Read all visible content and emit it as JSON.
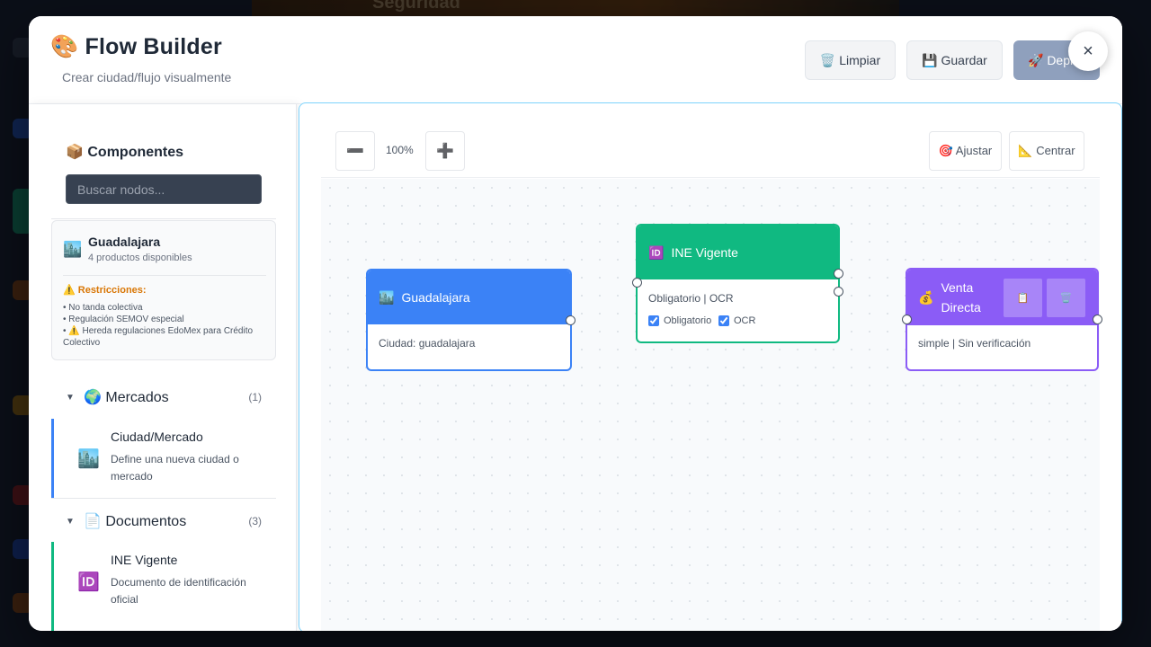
{
  "background": {
    "window_title": "Seguridad"
  },
  "header": {
    "title_icon": "🎨",
    "title": "Flow Builder",
    "subtitle": "Crear ciudad/flujo visualmente",
    "buttons": {
      "clear": "🗑️ Limpiar",
      "save": "💾 Guardar",
      "deploy": "🚀 Deploy"
    },
    "close": "×"
  },
  "sidebar": {
    "title": "📦 Componentes",
    "search_placeholder": "Buscar nodos...",
    "city_card": {
      "icon": "🏙️",
      "name": "Guadalajara",
      "products": "4 productos disponibles",
      "restrictions_title": "⚠️ Restricciones:",
      "restrictions": [
        "• No tanda colectiva",
        "• Regulación SEMOV especial",
        "• ⚠️ Hereda regulaciones EdoMex para Crédito Colectivo"
      ]
    },
    "categories": [
      {
        "arrow": "▼",
        "name": "🌍 Mercados",
        "count": "(1)",
        "items": [
          {
            "icon": "🏙️",
            "title": "Ciudad/Mercado",
            "desc": "Define una nueva ciudad o mercado"
          }
        ]
      },
      {
        "arrow": "▼",
        "name": "📄 Documentos",
        "count": "(3)",
        "items": [
          {
            "icon": "🆔",
            "title": "INE Vigente",
            "desc": "Documento de identificación oficial"
          }
        ]
      }
    ]
  },
  "canvas": {
    "zoom": "100%",
    "zoom_out": "➖",
    "zoom_in": "➕",
    "fit": "🎯 Ajustar",
    "center": "📐 Centrar",
    "nodes": [
      {
        "icon": "🏙️",
        "title": "Guadalajara",
        "body": "Ciudad: guadalajara",
        "color": "#3b82f6"
      },
      {
        "icon": "🆔",
        "title": "INE Vigente",
        "body": "Obligatorio | OCR",
        "color": "#10b981",
        "checks": [
          {
            "label": "Obligatorio",
            "checked": true
          },
          {
            "label": "OCR",
            "checked": true
          }
        ]
      },
      {
        "icon": "💰",
        "title": "Venta Directa",
        "body": "simple | Sin verificación",
        "color": "#8b5cf6",
        "actions": [
          "📋",
          "🗑️"
        ]
      }
    ]
  },
  "colors": {
    "accent": "#3b82f6",
    "success": "#10b981",
    "purple": "#8b5cf6",
    "warning": "#d97706"
  }
}
